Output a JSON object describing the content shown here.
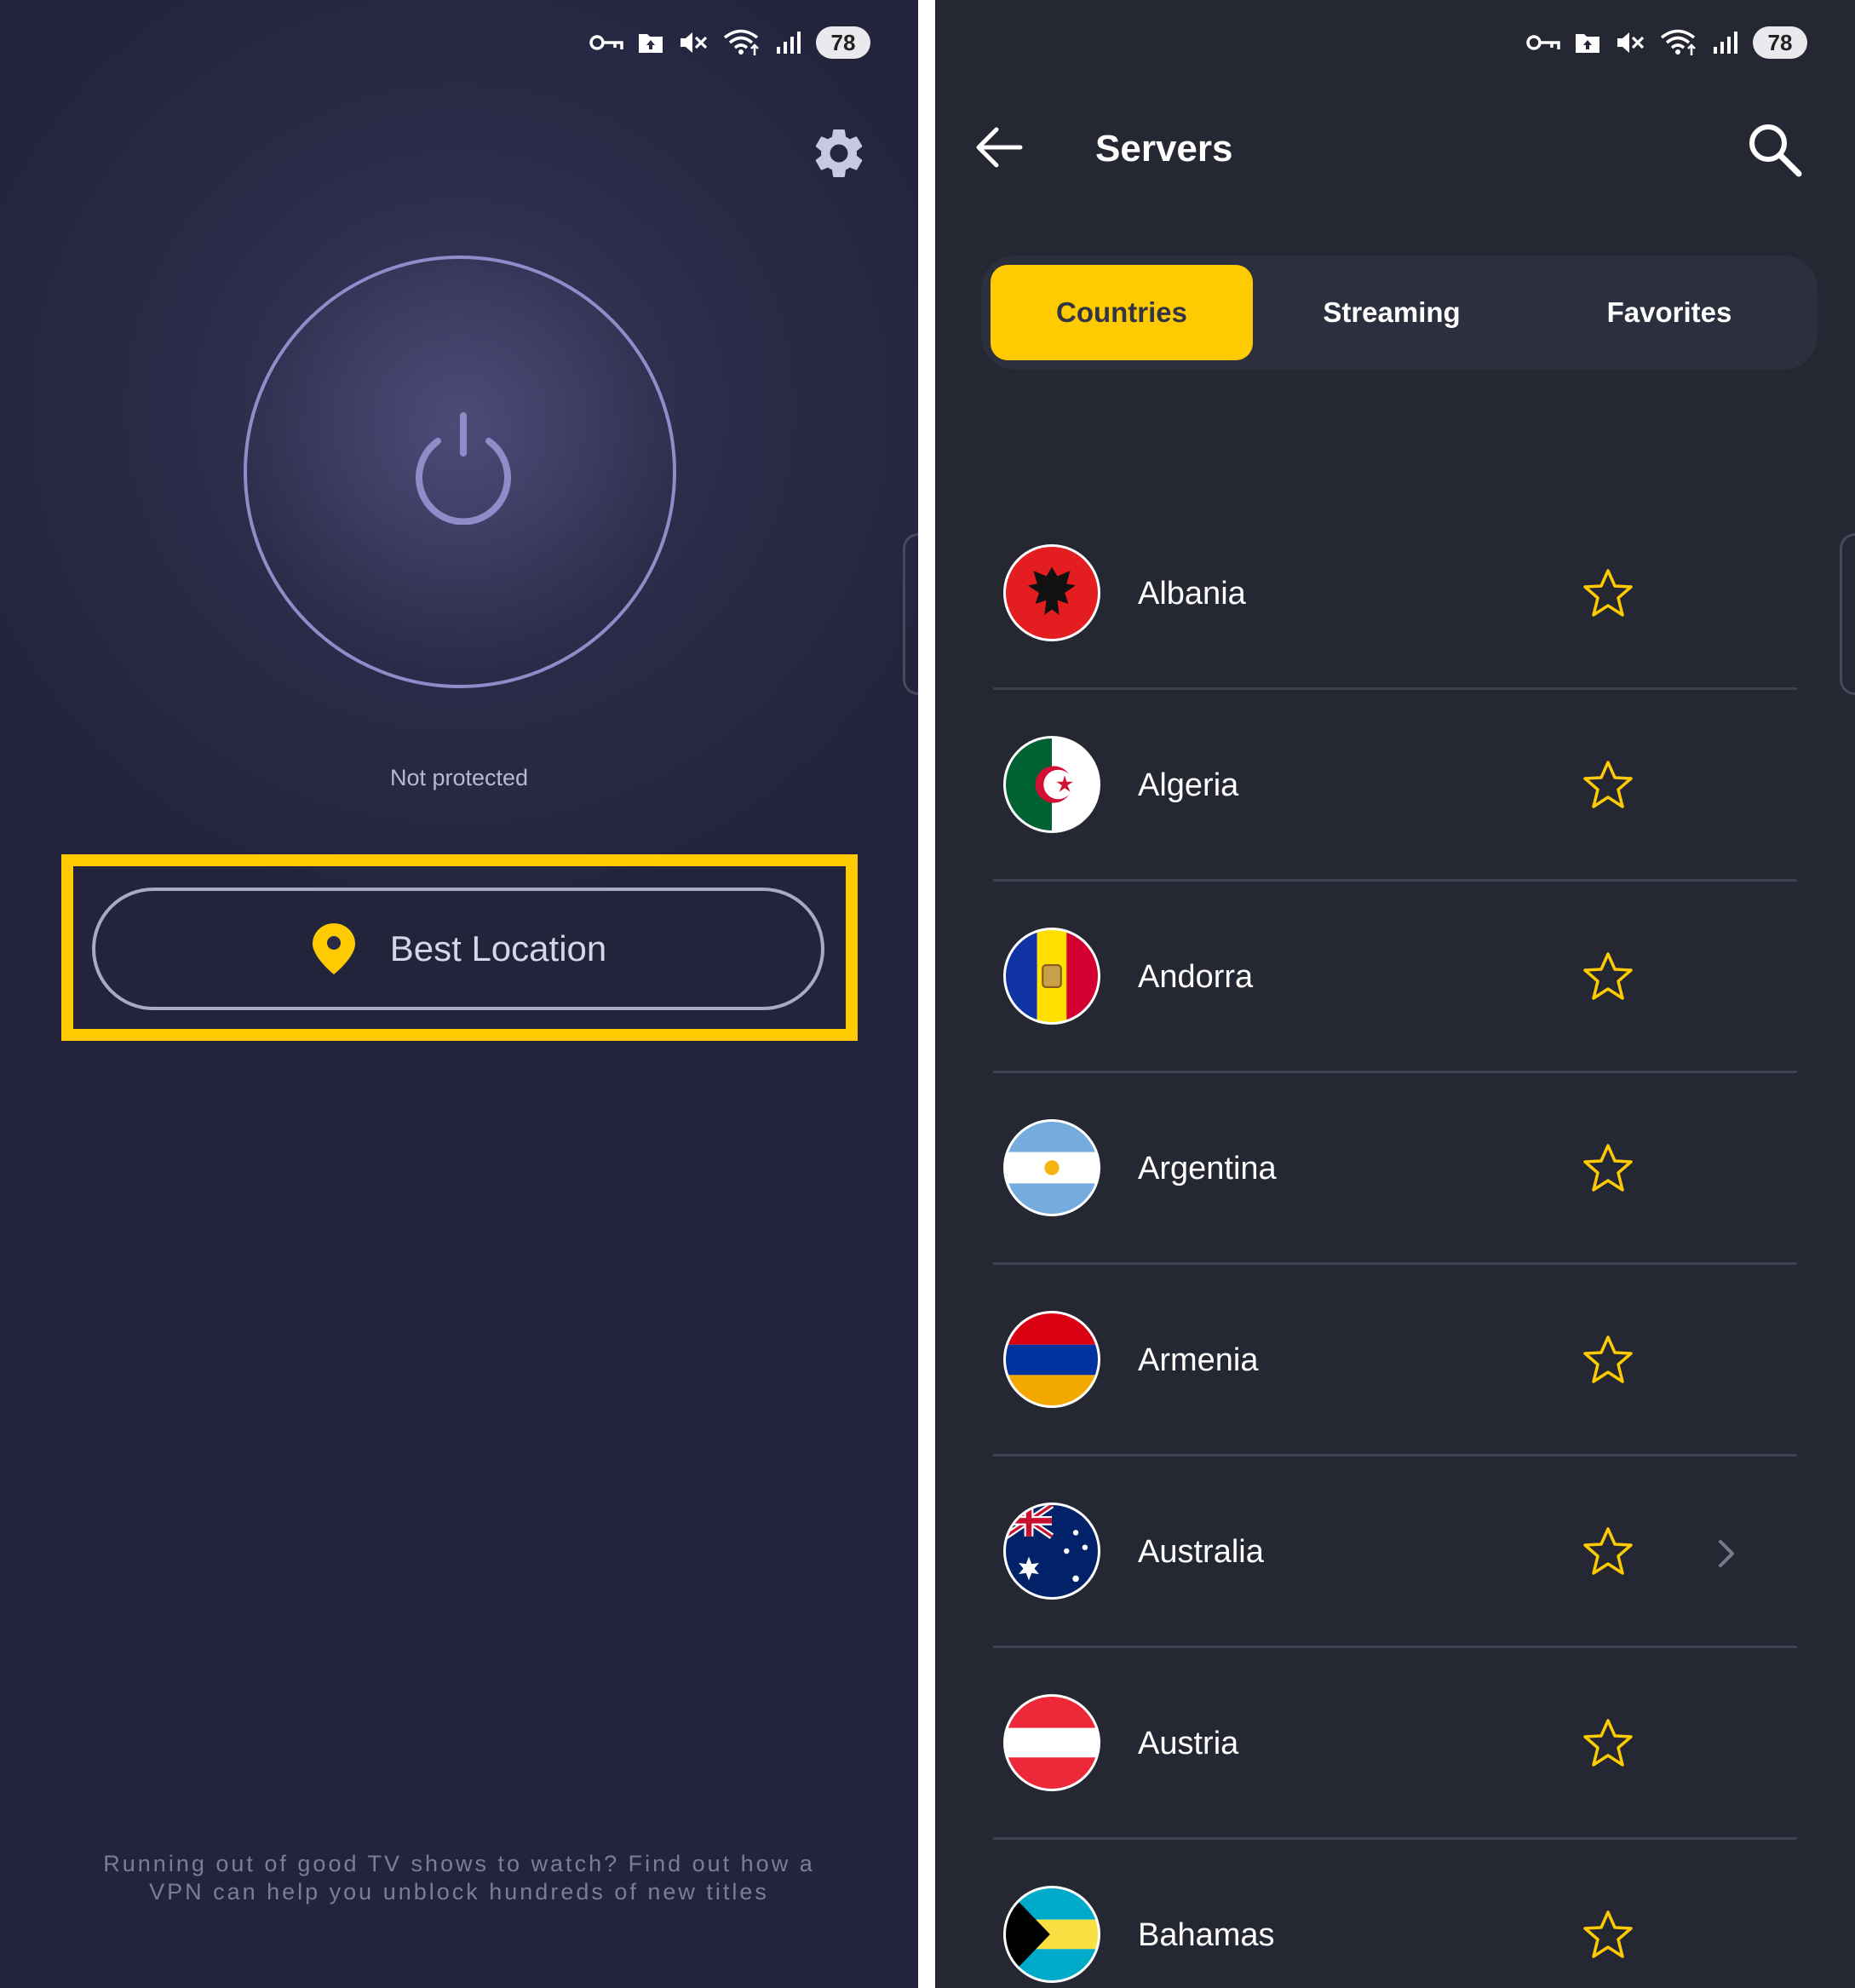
{
  "left_screen": {
    "status_bar": {
      "battery": "78"
    },
    "connection_status": "Not protected",
    "location_button": {
      "label": "Best Location"
    },
    "promo_text": {
      "line1": "Running out of good TV shows to watch? Find out how a",
      "line2": "VPN can help you unblock hundreds of new titles"
    },
    "highlight_color": "#fecb02"
  },
  "right_screen": {
    "status_bar": {
      "battery": "78"
    },
    "header": {
      "title": "Servers"
    },
    "tabs": [
      {
        "label": "Countries",
        "active": true
      },
      {
        "label": "Streaming",
        "active": false
      },
      {
        "label": "Favorites",
        "active": false
      }
    ],
    "countries": [
      {
        "name": "Albania",
        "flag_icon": "flag-albania-icon"
      },
      {
        "name": "Algeria",
        "flag_icon": "flag-algeria-icon"
      },
      {
        "name": "Andorra",
        "flag_icon": "flag-andorra-icon"
      },
      {
        "name": "Argentina",
        "flag_icon": "flag-argentina-icon"
      },
      {
        "name": "Armenia",
        "flag_icon": "flag-armenia-icon"
      },
      {
        "name": "Australia",
        "flag_icon": "flag-australia-icon",
        "has_submenu": true
      },
      {
        "name": "Austria",
        "flag_icon": "flag-austria-icon"
      },
      {
        "name": "Bahamas",
        "flag_icon": "flag-bahamas-icon"
      }
    ],
    "accent_color": "#fecb02"
  }
}
